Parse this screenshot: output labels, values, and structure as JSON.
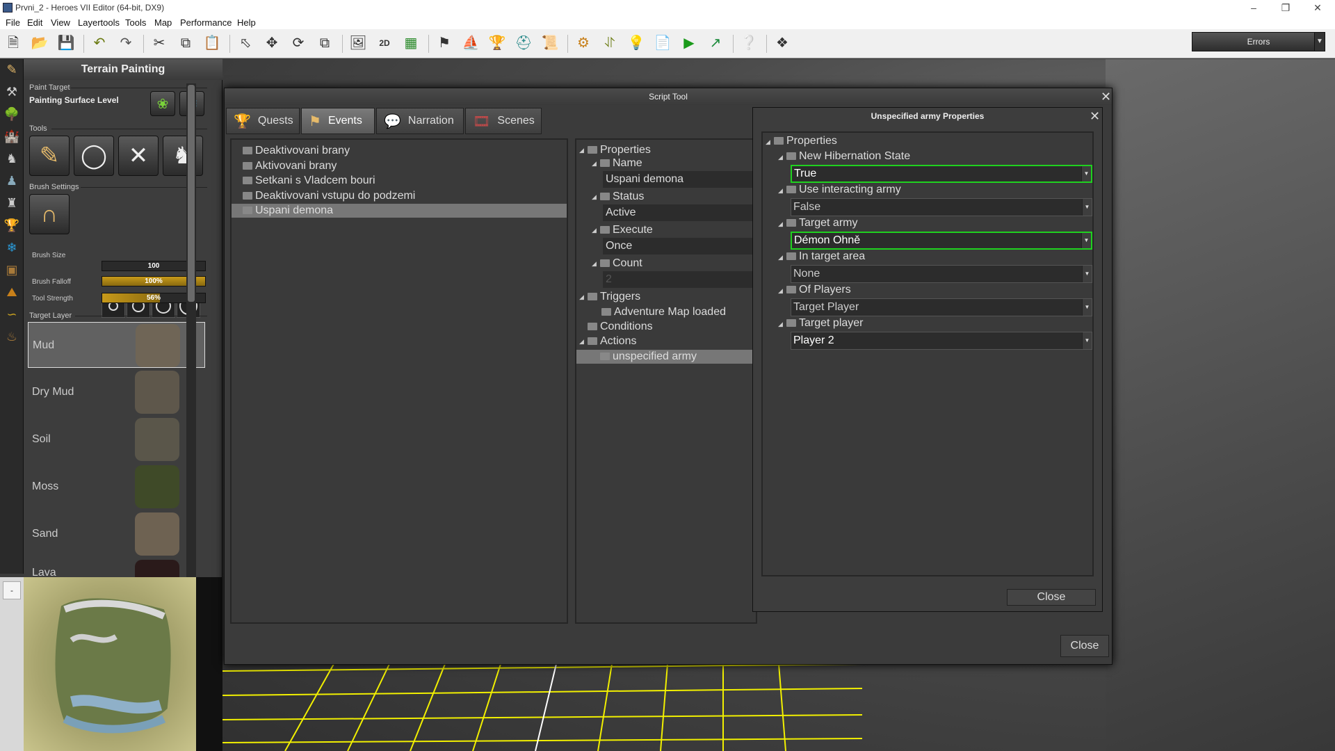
{
  "window": {
    "title": "Prvni_2 - Heroes VII Editor (64-bit, DX9)"
  },
  "menu": [
    "File",
    "Edit",
    "View",
    "Layertools",
    "Tools",
    "Map",
    "Performance",
    "Help"
  ],
  "toolbar": {
    "errors_label": "Errors"
  },
  "terrain": {
    "title": "Terrain Painting",
    "paint_target_label": "Paint Target",
    "painting_surface": "Painting Surface Level",
    "tools_label": "Tools",
    "brush_settings_label": "Brush Settings",
    "brush_size_label": "Brush Size",
    "brush_size_value": "100",
    "brush_falloff_label": "Brush Falloff",
    "brush_falloff_value": "100%",
    "tool_strength_label": "Tool Strength",
    "tool_strength_value": "56%",
    "tool_strength_fraction": 0.56,
    "target_layer_label": "Target Layer",
    "layers": [
      {
        "name": "Mud",
        "color": "#6f6556"
      },
      {
        "name": "Dry Mud",
        "color": "#5e574b"
      },
      {
        "name": "Soil",
        "color": "#5a564a"
      },
      {
        "name": "Moss",
        "color": "#3f4a28"
      },
      {
        "name": "Sand",
        "color": "#6e6252"
      },
      {
        "name": "Lava",
        "color": "#2a1a1a"
      }
    ],
    "minimap_dash": "-"
  },
  "script_tool": {
    "title": "Script Tool",
    "tabs": [
      "Quests",
      "Events",
      "Narration",
      "Scenes"
    ],
    "events": [
      "Deaktivovani brany",
      "Aktivovani brany",
      "Setkani s Vladcem bouri",
      "Deaktivovani vstupu do podzemi",
      "Uspani demona"
    ],
    "tree": {
      "properties": "Properties",
      "name_label": "Name",
      "name_value": "Uspani demona",
      "status_label": "Status",
      "status_value": "Active",
      "execute_label": "Execute",
      "execute_value": "Once",
      "count_label": "Count",
      "count_value": "2",
      "triggers": "Triggers",
      "trigger_item": "Adventure Map loaded",
      "conditions": "Conditions",
      "actions": "Actions",
      "action_item": "unspecified army"
    },
    "close_label": "Close"
  },
  "props": {
    "title": "Unspecified army Properties",
    "root": "Properties",
    "hibernation_label": "New Hibernation State",
    "hibernation_value": "True",
    "use_interacting_label": "Use interacting army",
    "use_interacting_value": "False",
    "target_army_label": "Target army",
    "target_army_value": "Démon Ohně",
    "target_area_label": "In target area",
    "target_area_value": "None",
    "of_players_label": "Of Players",
    "of_players_value": "Target Player",
    "target_player_label": "Target player",
    "target_player_value": "Player 2",
    "close_label": "Close",
    "highlight_color": "#1fd11f"
  }
}
